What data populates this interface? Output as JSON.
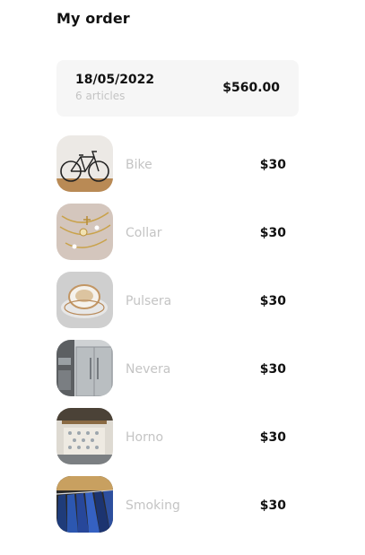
{
  "header": {
    "title": "My order"
  },
  "summary": {
    "date": "18/05/2022",
    "articles": "6 articles",
    "total": "$560.00"
  },
  "items": [
    {
      "name": "Bike",
      "price": "$30",
      "image_icon": "bike-image"
    },
    {
      "name": "Collar",
      "price": "$30",
      "image_icon": "necklace-image"
    },
    {
      "name": "Pulsera",
      "price": "$30",
      "image_icon": "bracelet-image"
    },
    {
      "name": "Nevera",
      "price": "$30",
      "image_icon": "fridge-image"
    },
    {
      "name": "Horno",
      "price": "$30",
      "image_icon": "oven-image"
    },
    {
      "name": "Smoking",
      "price": "$30",
      "image_icon": "suits-image"
    }
  ]
}
